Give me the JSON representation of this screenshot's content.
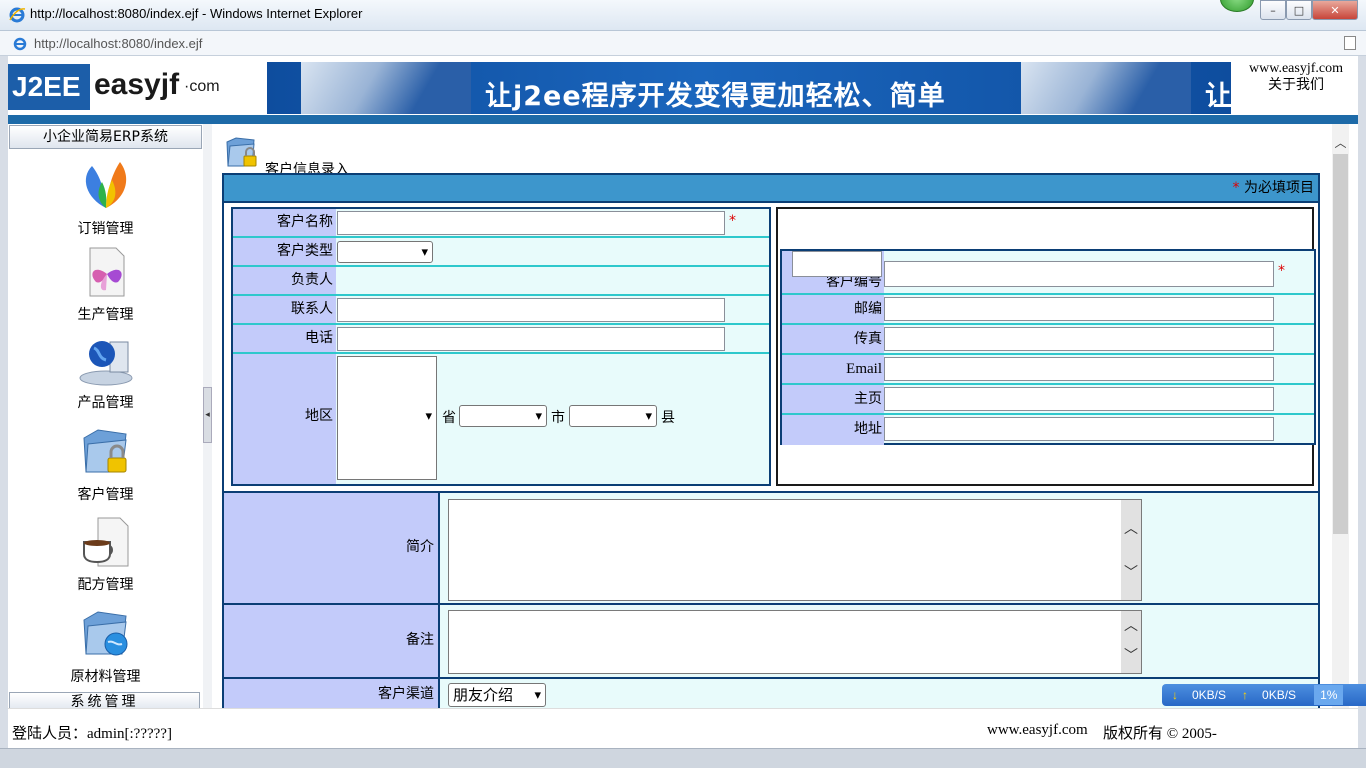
{
  "window": {
    "title": "http://localhost:8080/index.ejf - Windows Internet Explorer",
    "address": "http://localhost:8080/index.ejf",
    "btn_min": "–",
    "btn_max": "□",
    "btn_close": "✕"
  },
  "banner": {
    "logo_j2ee": "J2EE",
    "logo_name": "easyjf",
    "logo_dotcom": "·com",
    "slogan": "让j2ee程序开发变得更加轻松、简单",
    "slogan_repeat": "让",
    "site": "www.easyjf.com",
    "about": "关于我们"
  },
  "sidebar": {
    "header": "小企业简易ERP系统",
    "items": [
      {
        "label": "订销管理",
        "icon": "butterfly-logo-icon"
      },
      {
        "label": "生产管理",
        "icon": "butterfly-doc-icon"
      },
      {
        "label": "产品管理",
        "icon": "globe-computer-icon"
      },
      {
        "label": "客户管理",
        "icon": "folder-lock-icon"
      },
      {
        "label": "配方管理",
        "icon": "coffee-cup-icon"
      },
      {
        "label": "原材料管理",
        "icon": "folder-globe-icon"
      }
    ],
    "footer": "系统管理"
  },
  "page": {
    "title": "客户信息录入",
    "required_star": "*",
    "required_note": "为必填项目"
  },
  "form_left": {
    "customer_name": {
      "label": "客户名称",
      "value": "",
      "star": "*"
    },
    "customer_type": {
      "label": "客户类型",
      "value": ""
    },
    "manager": {
      "label": "负责人"
    },
    "contact": {
      "label": "联系人",
      "value": ""
    },
    "phone": {
      "label": "电话",
      "value": ""
    },
    "region": {
      "label": "地区",
      "province_suffix": "省",
      "city_suffix": "市",
      "county_suffix": "县"
    }
  },
  "form_right": {
    "customer_no": {
      "label": "客户编号",
      "value": "",
      "star": "*"
    },
    "postcode": {
      "label": "邮编",
      "value": ""
    },
    "fax": {
      "label": "传真",
      "value": ""
    },
    "email": {
      "label": "Email",
      "value": ""
    },
    "homepage": {
      "label": "主页",
      "value": ""
    },
    "address": {
      "label": "地址",
      "value": ""
    }
  },
  "form_bottom": {
    "intro": {
      "label": "简介",
      "value": ""
    },
    "remark": {
      "label": "备注",
      "value": ""
    },
    "channel": {
      "label": "客户渠道",
      "value": "朋友介绍"
    }
  },
  "status": {
    "login": "登陆人员：admin[:?????]",
    "site": "www.easyjf.com",
    "copyright": "版权所有 © 2005-"
  },
  "net_meter": {
    "down": "0KB/S",
    "up": "0KB/S",
    "percent": "1%"
  }
}
